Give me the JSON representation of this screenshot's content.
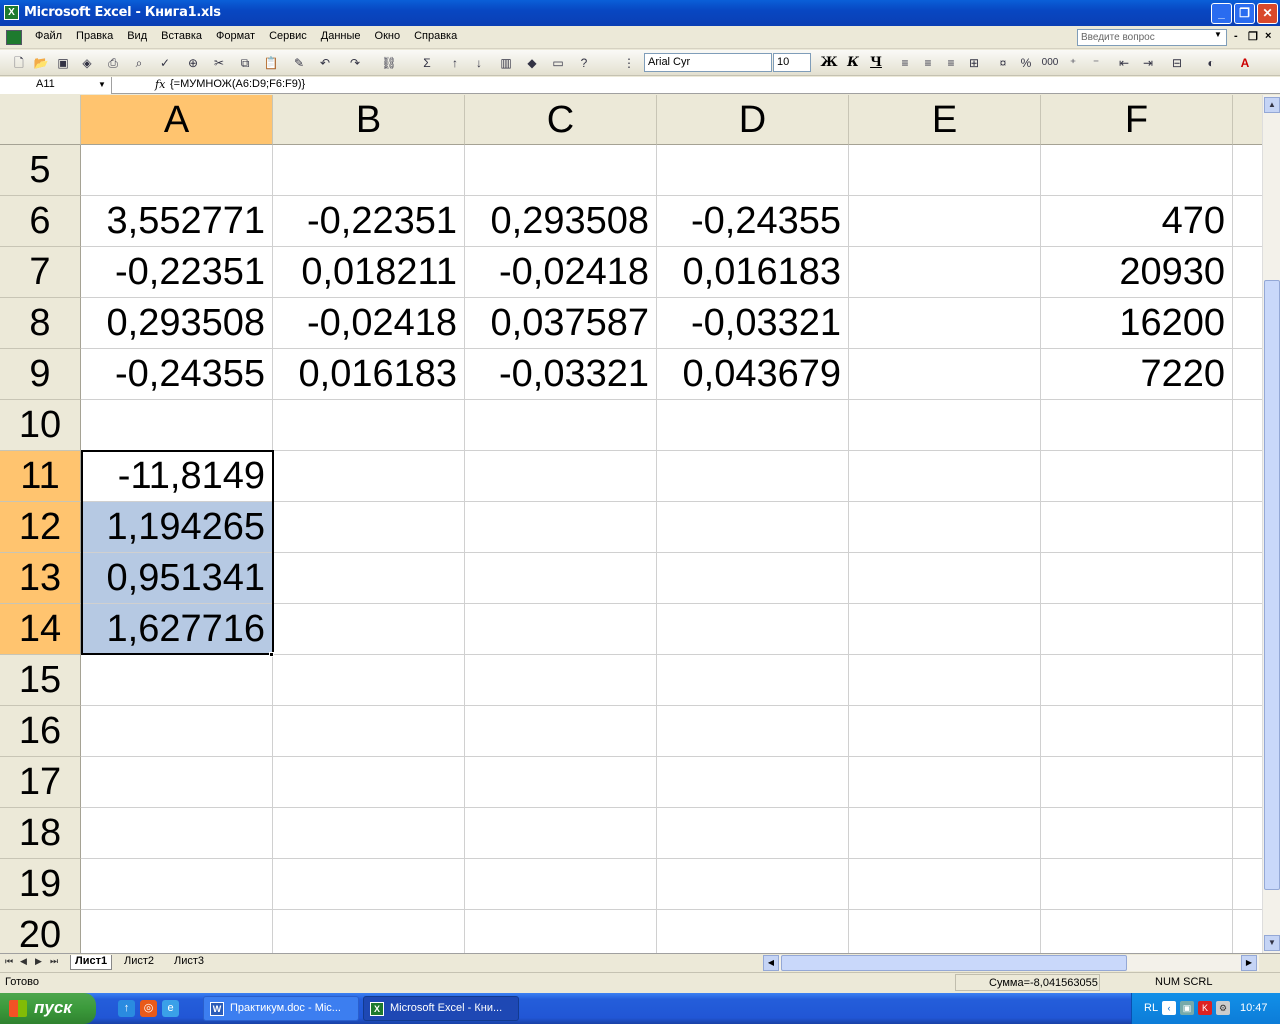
{
  "window": {
    "title": "Microsoft Excel - Книга1.xls"
  },
  "menu": {
    "items": [
      "Файл",
      "Правка",
      "Вид",
      "Вставка",
      "Формат",
      "Сервис",
      "Данные",
      "Окно",
      "Справка"
    ],
    "ask_placeholder": "Введите вопрос"
  },
  "toolbar": {
    "font_name": "Arial Cyr",
    "font_size": "10",
    "bold": "Ж",
    "italic": "К",
    "underline": "Ч",
    "percent": "%",
    "thousands": "000"
  },
  "formula_bar": {
    "name_box": "A11",
    "fx": "fx",
    "formula": "{=МУМНОЖ(A6:D9;F6:F9)}"
  },
  "sheet": {
    "columns": [
      "A",
      "B",
      "C",
      "D",
      "E",
      "F"
    ],
    "selected_column": "A",
    "rows": [
      {
        "num": "5",
        "cells": [
          "",
          "",
          "",
          "",
          "",
          ""
        ]
      },
      {
        "num": "6",
        "cells": [
          "3,552771",
          "-0,22351",
          "0,293508",
          "-0,24355",
          "",
          "470"
        ]
      },
      {
        "num": "7",
        "cells": [
          "-0,22351",
          "0,018211",
          "-0,02418",
          "0,016183",
          "",
          "20930"
        ]
      },
      {
        "num": "8",
        "cells": [
          "0,293508",
          "-0,02418",
          "0,037587",
          "-0,03321",
          "",
          "16200"
        ]
      },
      {
        "num": "9",
        "cells": [
          "-0,24355",
          "0,016183",
          "-0,03321",
          "0,043679",
          "",
          "7220"
        ]
      },
      {
        "num": "10",
        "cells": [
          "",
          "",
          "",
          "",
          "",
          ""
        ]
      },
      {
        "num": "11",
        "cells": [
          "-11,8149",
          "",
          "",
          "",
          "",
          ""
        ]
      },
      {
        "num": "12",
        "cells": [
          "1,194265",
          "",
          "",
          "",
          "",
          ""
        ]
      },
      {
        "num": "13",
        "cells": [
          "0,951341",
          "",
          "",
          "",
          "",
          ""
        ]
      },
      {
        "num": "14",
        "cells": [
          "1,627716",
          "",
          "",
          "",
          "",
          ""
        ]
      },
      {
        "num": "15",
        "cells": [
          "",
          "",
          "",
          "",
          "",
          ""
        ]
      },
      {
        "num": "16",
        "cells": [
          "",
          "",
          "",
          "",
          "",
          ""
        ]
      },
      {
        "num": "17",
        "cells": [
          "",
          "",
          "",
          "",
          "",
          ""
        ]
      },
      {
        "num": "18",
        "cells": [
          "",
          "",
          "",
          "",
          "",
          ""
        ]
      },
      {
        "num": "19",
        "cells": [
          "",
          "",
          "",
          "",
          "",
          ""
        ]
      },
      {
        "num": "20",
        "cells": [
          "",
          "",
          "",
          "",
          "",
          ""
        ]
      }
    ],
    "selected_rows": [
      "11",
      "12",
      "13",
      "14"
    ]
  },
  "tabs": [
    "Лист1",
    "Лист2",
    "Лист3"
  ],
  "active_tab": "Лист1",
  "status": {
    "ready": "Готово",
    "sum": "Сумма=-8,041563055",
    "indicators": "NUM  SCRL"
  },
  "taskbar": {
    "start": "пуск",
    "buttons": [
      {
        "label": "Практикум.doc - Mic...",
        "icon": "word-icon",
        "active": false
      },
      {
        "label": "Microsoft Excel - Кни...",
        "icon": "excel-icon",
        "active": true
      }
    ],
    "lang": "RL",
    "clock": "10:47"
  },
  "colors": {
    "selected_header": "#ffc46f",
    "selection_fill": "#b6c9e3",
    "titlebar": "#0a47c2"
  }
}
